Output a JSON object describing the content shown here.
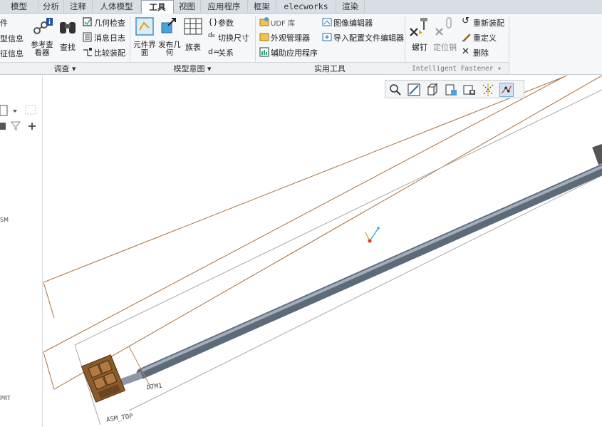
{
  "tabs": [
    "模型",
    "分析",
    "注释",
    "人体模型",
    "工具",
    "视图",
    "应用程序",
    "框架",
    "elecworks",
    "渲染"
  ],
  "active_tab": "工具",
  "ribbon": {
    "left_items": [
      "件",
      "型信息",
      "征信息"
    ],
    "investigate": {
      "ref_viewer": "参考查看器",
      "find": "查找",
      "geom_check": "几何检查",
      "msg_log": "消息日志",
      "compare_asm": "比较装配",
      "group_label": "调查"
    },
    "model_intent": {
      "component_interface": "元件界面",
      "publish_geom": "发布几何",
      "family_table": "族表",
      "params": "参数",
      "switch_dims": "切换尺寸",
      "relations": "关系",
      "group_label": "模型意图"
    },
    "utilities": {
      "udf_lib": "UDF 库",
      "appearance_mgr": "外观管理器",
      "aux_apps": "辅助应用程序",
      "image_editor": "图像编辑器",
      "import_config_editor": "导入配置文件编辑器",
      "group_label": "实用工具"
    },
    "fastener": {
      "screw": "螺钉",
      "locate_pin": "定位销",
      "reassemble": "重新装配",
      "redefine": "重定义",
      "delete": "删除",
      "group_label": "Intelligent Fastener"
    }
  },
  "left_panel": {
    "labels": [
      "SM",
      "PRT"
    ]
  },
  "viewport": {
    "annotations": [
      "DTM1",
      "ASM_TOP"
    ]
  }
}
